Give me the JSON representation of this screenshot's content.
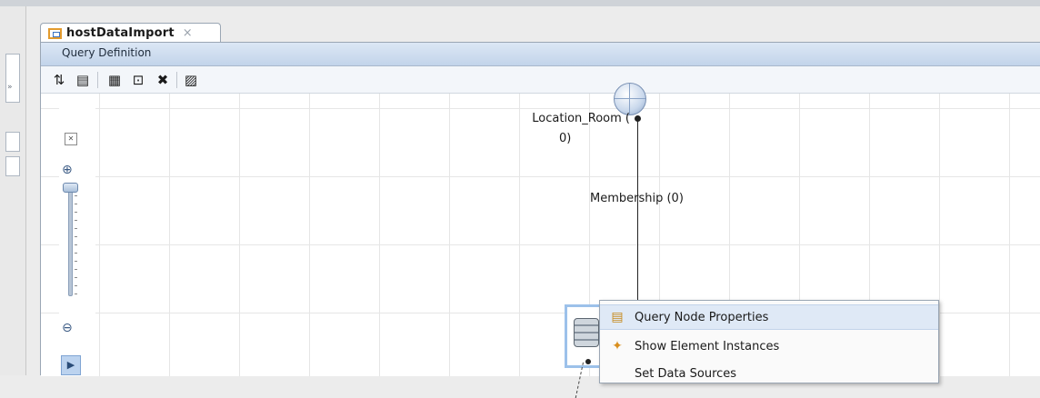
{
  "tab": {
    "title": "hostDataImport",
    "close_glyph": "×"
  },
  "section": {
    "title": "Query Definition"
  },
  "toolbar": {
    "buttons": [
      {
        "name": "sort-icon",
        "glyph": "⇅",
        "color": "#3c74c4"
      },
      {
        "name": "list-icon",
        "glyph": "▤",
        "color": "#5a6a7e"
      },
      {
        "name": "calculator-icon",
        "glyph": "▦",
        "color": "#5a6a7e"
      },
      {
        "name": "preview-icon",
        "glyph": "⊡",
        "color": "#3c74c4"
      },
      {
        "name": "delete-icon",
        "glyph": "✖",
        "color": "#e02020"
      },
      {
        "name": "properties-icon",
        "glyph": "▨",
        "color": "#c68a1c"
      }
    ]
  },
  "canvas": {
    "node_label": "Location_Room (",
    "node_label2": "0)",
    "edge_label": "Membership (0)"
  },
  "context_menu": {
    "items": [
      {
        "label": "Query Node Properties",
        "icon": "properties-icon",
        "glyph": "▤",
        "color": "#c68a1c"
      },
      {
        "label": "Show Element Instances",
        "icon": "element-instances-icon",
        "glyph": "✦",
        "color": "#d98f1e"
      },
      {
        "label": "Set Data Sources",
        "icon": "data-sources-icon",
        "glyph": "",
        "color": "#555555"
      }
    ]
  },
  "colors": {
    "header_gradient": "#c2d4ea",
    "selection": "#9cc1ea",
    "menu_highlight": "#dfe9f6"
  }
}
